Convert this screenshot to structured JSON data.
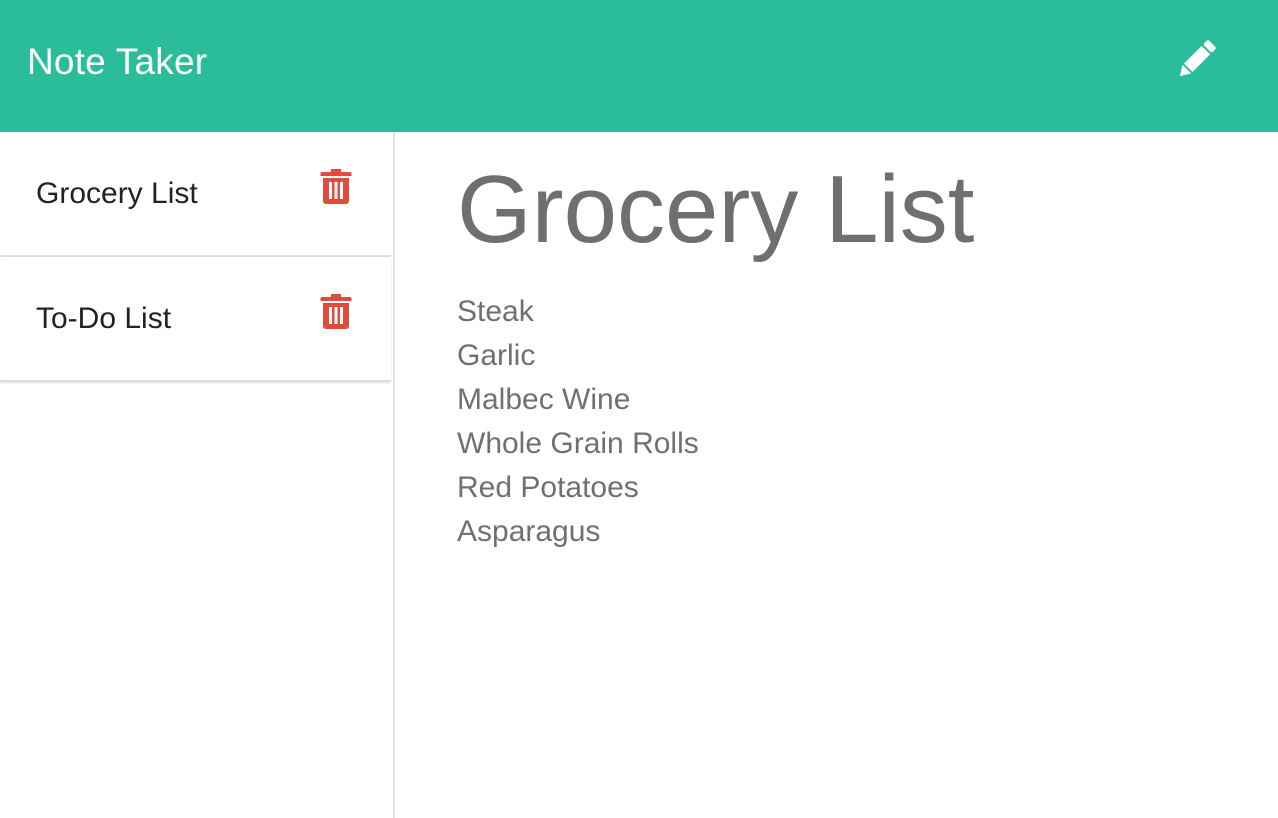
{
  "header": {
    "brand": "Note Taker",
    "new_note_icon": "pencil-icon"
  },
  "sidebar": {
    "notes": [
      {
        "title": "Grocery List",
        "delete_icon": "trash-icon"
      },
      {
        "title": "To-Do List",
        "delete_icon": "trash-icon"
      }
    ]
  },
  "main": {
    "title": "Grocery List",
    "body_lines": [
      "Steak",
      "Garlic",
      "Malbec Wine",
      "Whole Grain Rolls",
      "Red Potatoes",
      "Asparagus"
    ]
  },
  "colors": {
    "navbar": "#2bbd9b",
    "delete": "#e14b3b",
    "note_text": "#6f6f6f"
  }
}
